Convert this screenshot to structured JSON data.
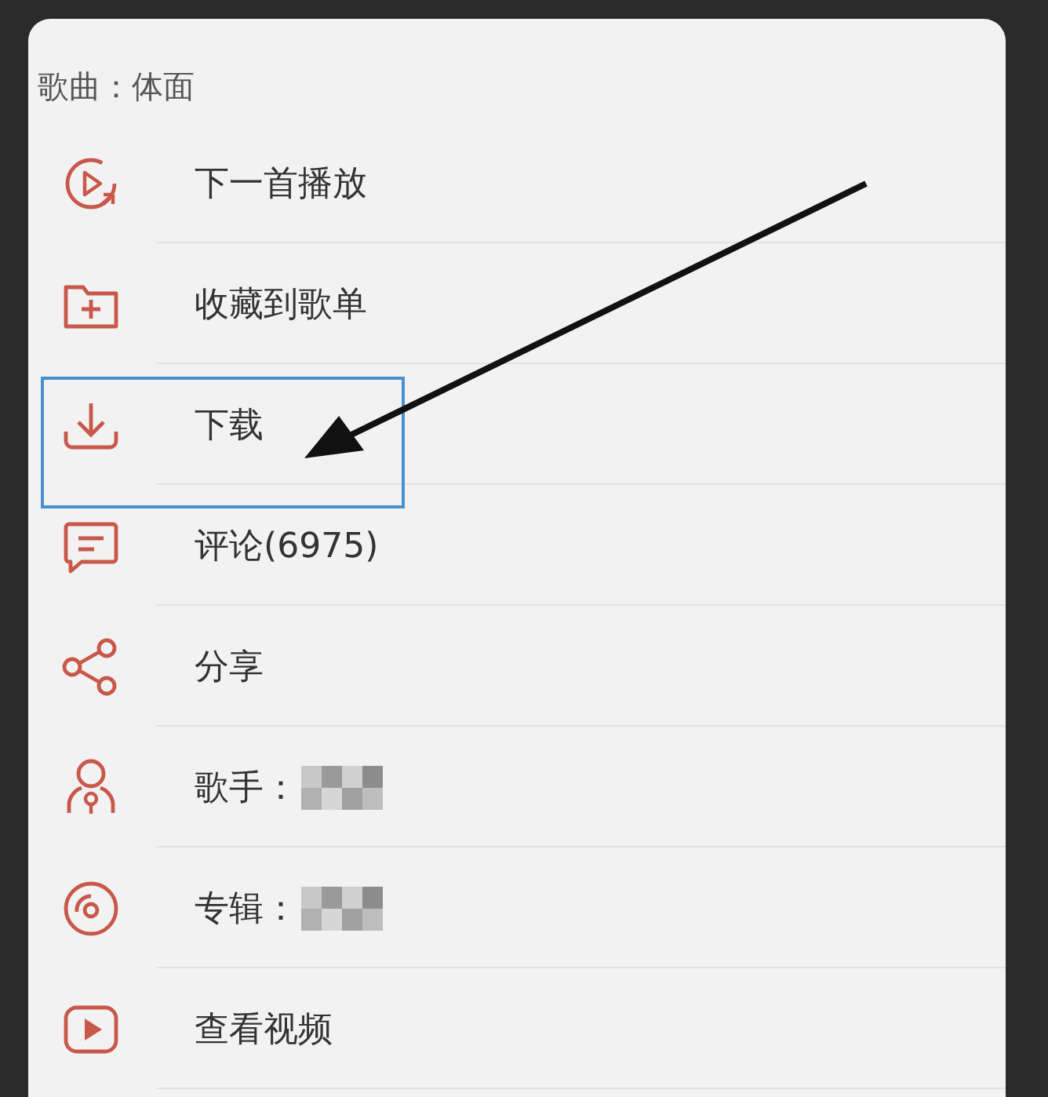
{
  "sheet": {
    "title": "歌曲：体面",
    "items": [
      {
        "label": "下一首播放",
        "kind": "play-next",
        "highlighted": false,
        "blurred_value": false
      },
      {
        "label": "收藏到歌单",
        "kind": "folder-add",
        "highlighted": false,
        "blurred_value": false
      },
      {
        "label": "下载",
        "kind": "download",
        "highlighted": true,
        "blurred_value": false
      },
      {
        "label": "评论(6975)",
        "kind": "comment",
        "highlighted": false,
        "blurred_value": false
      },
      {
        "label": "分享",
        "kind": "share",
        "highlighted": false,
        "blurred_value": false
      },
      {
        "label": "歌手：",
        "kind": "singer",
        "highlighted": false,
        "blurred_value": true
      },
      {
        "label": "专辑：",
        "kind": "album",
        "highlighted": false,
        "blurred_value": true
      },
      {
        "label": "查看视频",
        "kind": "video",
        "highlighted": false,
        "blurred_value": false
      }
    ]
  }
}
